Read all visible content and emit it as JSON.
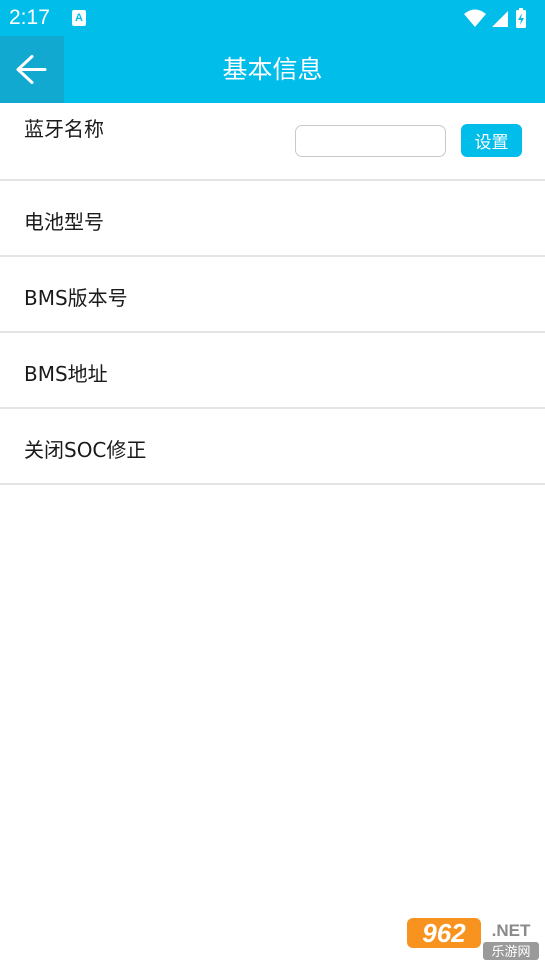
{
  "status_bar": {
    "time": "2:17",
    "notification_icon": "a-icon",
    "a_letter": "A",
    "icons": [
      "wifi-icon",
      "cellular-signal-icon",
      "battery-icon"
    ]
  },
  "app_bar": {
    "title": "基本信息",
    "back_icon": "arrow-left-icon"
  },
  "bluetooth_name": {
    "label": "蓝牙名称",
    "input_value": "",
    "button_label": "设置"
  },
  "rows": [
    {
      "label": "电池型号"
    },
    {
      "label": "BMS版本号"
    },
    {
      "label": "BMS地址"
    },
    {
      "label": "关闭SOC修正"
    }
  ],
  "watermark": {
    "number": "962",
    "suffix": ".NET",
    "site": "乐游网"
  },
  "colors": {
    "accent": "#00bdea",
    "back_button_bg": "#12a9d0",
    "divider": "#e4e4e4"
  }
}
